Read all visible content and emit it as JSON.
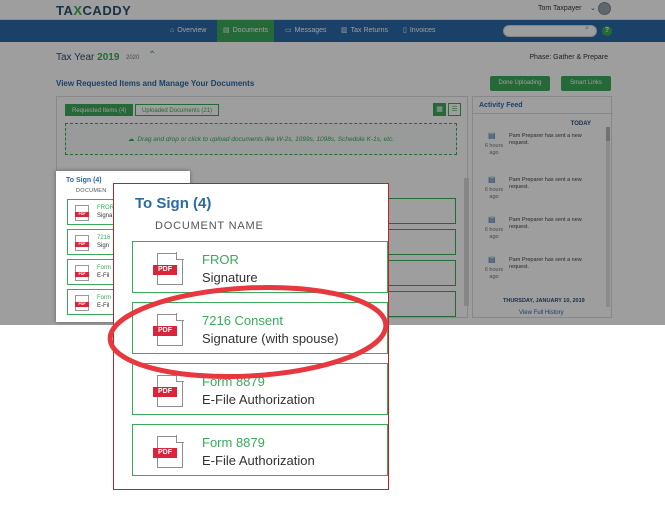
{
  "app": {
    "logo_text_a": "TA",
    "logo_text_b": "X",
    "logo_text_c": "CADDY",
    "user_name": "Tom Taxpayer",
    "help_label": "?"
  },
  "nav": {
    "items": [
      {
        "label": "Overview",
        "icon": "home-icon"
      },
      {
        "label": "Documents",
        "icon": "document-icon"
      },
      {
        "label": "Messages",
        "icon": "chat-icon"
      },
      {
        "label": "Tax Returns",
        "icon": "return-icon"
      },
      {
        "label": "Invoices",
        "icon": "invoice-icon"
      }
    ],
    "active": "Documents"
  },
  "header": {
    "tax_year_label": "Tax Year",
    "tax_year": "2019",
    "prev_year": "2020",
    "phase": "Phase: Gather & Prepare"
  },
  "main": {
    "section_title": "View Requested Items and Manage Your Documents",
    "done_uploading": "Done Uploading",
    "smart_links": "Smart Links",
    "tabs": [
      "Requested Items (4)",
      "Uploaded Documents (21)"
    ],
    "dropzone_text": "Drag and drop or click to upload documents like W-2s, 1099s, 1098s, Schedule K-1s, etc."
  },
  "activity": {
    "title": "Activity Feed",
    "today": "TODAY",
    "items": [
      {
        "time": "6 hours ago",
        "text": "Pam Preparer has sent a new request."
      },
      {
        "time": "6 hours ago",
        "text": "Pam Preparer has sent a new request."
      },
      {
        "time": "6 hours ago",
        "text": "Pam Preparer has sent a new request."
      },
      {
        "time": "6 hours ago",
        "text": "Pam Preparer has sent a new request."
      }
    ],
    "date_divider": "THURSDAY, JANUARY 10, 2019",
    "view_full": "View Full History"
  },
  "to_sign": {
    "title": "To Sign (4)",
    "column_header": "DOCUMENT NAME",
    "pdf_label": "PDF",
    "mini_sub": "DOCUMEN",
    "docs": [
      {
        "name": "FROR",
        "type": "Signature",
        "mini_name": "FROR",
        "mini_type": "Signa"
      },
      {
        "name": "7216 Consent",
        "type": "Signature (with spouse)",
        "mini_name": "7216",
        "mini_type": "Sign"
      },
      {
        "name": "Form 8879",
        "type": "E-File Authorization",
        "mini_name": "Form",
        "mini_type": "E-Fil"
      },
      {
        "name": "Form 8879",
        "type": "E-File Authorization",
        "mini_name": "Form",
        "mini_type": "E-Fil"
      }
    ]
  },
  "colors": {
    "brand_blue": "#2a6aa6",
    "brand_green": "#3aaa5a",
    "pdf_red": "#d9243b",
    "callout_red": "#e8373f"
  }
}
